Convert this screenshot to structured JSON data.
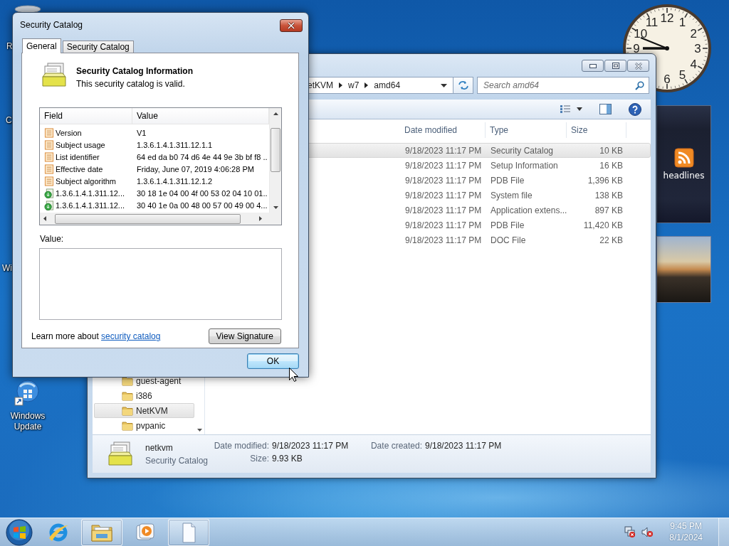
{
  "desktop": {
    "cut_labels": [
      "R",
      "C",
      "Wi"
    ],
    "icons": [
      {
        "label": "Windows Update"
      }
    ]
  },
  "gadgets": {
    "clock_numerals": [
      "12",
      "1",
      "2",
      "3",
      "4",
      "5",
      "6",
      "9",
      "10",
      "11"
    ],
    "feed_label": "headlines"
  },
  "explorer": {
    "breadcrumb": [
      "etKVM",
      "w7",
      "amd64"
    ],
    "search": {
      "placeholder": "Search amd64"
    },
    "nav_items": [
      {
        "label": "guest-agent",
        "selected": false
      },
      {
        "label": "i386",
        "selected": false
      },
      {
        "label": "NetKVM",
        "selected": true
      },
      {
        "label": "pvpanic",
        "selected": false
      }
    ],
    "columns": [
      "Date modified",
      "Type",
      "Size"
    ],
    "rows": [
      {
        "date": "9/18/2023 11:17 PM",
        "type": "Security Catalog",
        "size": "10 KB",
        "selected": true
      },
      {
        "date": "9/18/2023 11:17 PM",
        "type": "Setup Information",
        "size": "16 KB",
        "selected": false
      },
      {
        "date": "9/18/2023 11:17 PM",
        "type": "PDB File",
        "size": "1,396 KB",
        "selected": false
      },
      {
        "date": "9/18/2023 11:17 PM",
        "type": "System file",
        "size": "138 KB",
        "selected": false
      },
      {
        "date": "9/18/2023 11:17 PM",
        "type": "Application extens...",
        "size": "897 KB",
        "selected": false
      },
      {
        "date": "9/18/2023 11:17 PM",
        "type": "PDB File",
        "size": "11,420 KB",
        "selected": false
      },
      {
        "date": "9/18/2023 11:17 PM",
        "type": "DOC File",
        "size": "22 KB",
        "selected": false
      }
    ],
    "details": {
      "name": "netkvm",
      "type": "Security Catalog",
      "fields": [
        {
          "label": "Date modified:",
          "value": "9/18/2023 11:17 PM"
        },
        {
          "label": "Date created:",
          "value": "9/18/2023 11:17 PM"
        },
        {
          "label": "Size:",
          "value": "9.93 KB"
        }
      ]
    }
  },
  "dialog": {
    "title": "Security Catalog",
    "tabs": [
      {
        "label": "General",
        "selected": true
      },
      {
        "label": "Security Catalog",
        "selected": false
      }
    ],
    "heading": "Security Catalog Information",
    "status": "This security catalog is valid.",
    "columns": [
      "Field",
      "Value"
    ],
    "rows": [
      {
        "kind": "property",
        "field": "Version",
        "value": "V1"
      },
      {
        "kind": "property",
        "field": "Subject usage",
        "value": "1.3.6.1.4.1.311.12.1.1"
      },
      {
        "kind": "property",
        "field": "List identifier",
        "value": "64 ed da b0 74 d6 4e 44 9e 3b bf f8 .."
      },
      {
        "kind": "property",
        "field": "Effective date",
        "value": "Friday, June 07, 2019 4:06:28 PM"
      },
      {
        "kind": "property",
        "field": "Subject algorithm",
        "value": "1.3.6.1.4.1.311.12.1.2"
      },
      {
        "kind": "extension",
        "field": "1.3.6.1.4.1.311.12...",
        "value": "30 18 1e 04 00 4f 00 53 02 04 10 01.."
      },
      {
        "kind": "extension",
        "field": "1.3.6.1.4.1.311.12...",
        "value": "30 40 1e 0a 00 48 00 57 00 49 00 4..."
      }
    ],
    "value_label": "Value:",
    "learn_more": {
      "text": "Learn more about",
      "link": "security catalog"
    },
    "view_signature": "View Signature",
    "ok": "OK"
  },
  "taskbar": {
    "apps": [
      {
        "kind": "browser",
        "open": false
      },
      {
        "kind": "folder",
        "open": true
      },
      {
        "kind": "media",
        "open": false
      },
      {
        "kind": "document",
        "open": true
      }
    ],
    "time": "9:45 PM",
    "date": "8/1/2024"
  }
}
